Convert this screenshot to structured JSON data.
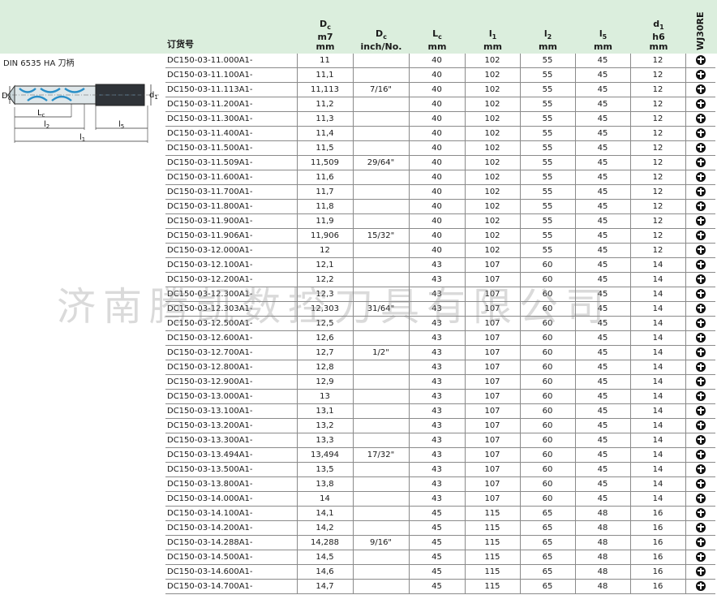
{
  "header": {
    "order_no": "订货号",
    "dc_mm": [
      "D",
      "c",
      "m7",
      "mm"
    ],
    "dc_inch": [
      "D",
      "c",
      "inch/No."
    ],
    "lc": [
      "L",
      "c",
      "mm"
    ],
    "l1": [
      "l",
      "1",
      "mm"
    ],
    "l2": [
      "l",
      "2",
      "mm"
    ],
    "l5": [
      "l",
      "5",
      "mm"
    ],
    "d1": [
      "d",
      "1",
      "h6",
      "mm"
    ],
    "grade": "WJ30RE"
  },
  "product": {
    "label": "DIN 6535 HA 刀柄",
    "drawing_labels": {
      "dc": "Dc",
      "d1": "d1",
      "lc": "Lc",
      "l2": "l2",
      "l5": "l5",
      "l1": "l1"
    }
  },
  "watermark": "济南腾凯数控刀具有限公司",
  "rows": [
    [
      "DC150-03-11.000A1-",
      "11",
      "",
      "40",
      "102",
      "55",
      "45",
      "12"
    ],
    [
      "DC150-03-11.100A1-",
      "11,1",
      "",
      "40",
      "102",
      "55",
      "45",
      "12"
    ],
    [
      "DC150-03-11.113A1-",
      "11,113",
      "7/16\"",
      "40",
      "102",
      "55",
      "45",
      "12"
    ],
    [
      "DC150-03-11.200A1-",
      "11,2",
      "",
      "40",
      "102",
      "55",
      "45",
      "12"
    ],
    [
      "DC150-03-11.300A1-",
      "11,3",
      "",
      "40",
      "102",
      "55",
      "45",
      "12"
    ],
    [
      "DC150-03-11.400A1-",
      "11,4",
      "",
      "40",
      "102",
      "55",
      "45",
      "12"
    ],
    [
      "DC150-03-11.500A1-",
      "11,5",
      "",
      "40",
      "102",
      "55",
      "45",
      "12"
    ],
    [
      "DC150-03-11.509A1-",
      "11,509",
      "29/64\"",
      "40",
      "102",
      "55",
      "45",
      "12"
    ],
    [
      "DC150-03-11.600A1-",
      "11,6",
      "",
      "40",
      "102",
      "55",
      "45",
      "12"
    ],
    [
      "DC150-03-11.700A1-",
      "11,7",
      "",
      "40",
      "102",
      "55",
      "45",
      "12"
    ],
    [
      "DC150-03-11.800A1-",
      "11,8",
      "",
      "40",
      "102",
      "55",
      "45",
      "12"
    ],
    [
      "DC150-03-11.900A1-",
      "11,9",
      "",
      "40",
      "102",
      "55",
      "45",
      "12"
    ],
    [
      "DC150-03-11.906A1-",
      "11,906",
      "15/32\"",
      "40",
      "102",
      "55",
      "45",
      "12"
    ],
    [
      "DC150-03-12.000A1-",
      "12",
      "",
      "40",
      "102",
      "55",
      "45",
      "12"
    ],
    [
      "DC150-03-12.100A1-",
      "12,1",
      "",
      "43",
      "107",
      "60",
      "45",
      "14"
    ],
    [
      "DC150-03-12.200A1-",
      "12,2",
      "",
      "43",
      "107",
      "60",
      "45",
      "14"
    ],
    [
      "DC150-03-12.300A1-",
      "12,3",
      "",
      "43",
      "107",
      "60",
      "45",
      "14"
    ],
    [
      "DC150-03-12.303A1-",
      "12,303",
      "31/64\"",
      "43",
      "107",
      "60",
      "45",
      "14"
    ],
    [
      "DC150-03-12.500A1-",
      "12,5",
      "",
      "43",
      "107",
      "60",
      "45",
      "14"
    ],
    [
      "DC150-03-12.600A1-",
      "12,6",
      "",
      "43",
      "107",
      "60",
      "45",
      "14"
    ],
    [
      "DC150-03-12.700A1-",
      "12,7",
      "1/2\"",
      "43",
      "107",
      "60",
      "45",
      "14"
    ],
    [
      "DC150-03-12.800A1-",
      "12,8",
      "",
      "43",
      "107",
      "60",
      "45",
      "14"
    ],
    [
      "DC150-03-12.900A1-",
      "12,9",
      "",
      "43",
      "107",
      "60",
      "45",
      "14"
    ],
    [
      "DC150-03-13.000A1-",
      "13",
      "",
      "43",
      "107",
      "60",
      "45",
      "14"
    ],
    [
      "DC150-03-13.100A1-",
      "13,1",
      "",
      "43",
      "107",
      "60",
      "45",
      "14"
    ],
    [
      "DC150-03-13.200A1-",
      "13,2",
      "",
      "43",
      "107",
      "60",
      "45",
      "14"
    ],
    [
      "DC150-03-13.300A1-",
      "13,3",
      "",
      "43",
      "107",
      "60",
      "45",
      "14"
    ],
    [
      "DC150-03-13.494A1-",
      "13,494",
      "17/32\"",
      "43",
      "107",
      "60",
      "45",
      "14"
    ],
    [
      "DC150-03-13.500A1-",
      "13,5",
      "",
      "43",
      "107",
      "60",
      "45",
      "14"
    ],
    [
      "DC150-03-13.800A1-",
      "13,8",
      "",
      "43",
      "107",
      "60",
      "45",
      "14"
    ],
    [
      "DC150-03-14.000A1-",
      "14",
      "",
      "43",
      "107",
      "60",
      "45",
      "14"
    ],
    [
      "DC150-03-14.100A1-",
      "14,1",
      "",
      "45",
      "115",
      "65",
      "48",
      "16"
    ],
    [
      "DC150-03-14.200A1-",
      "14,2",
      "",
      "45",
      "115",
      "65",
      "48",
      "16"
    ],
    [
      "DC150-03-14.288A1-",
      "14,288",
      "9/16\"",
      "45",
      "115",
      "65",
      "48",
      "16"
    ],
    [
      "DC150-03-14.500A1-",
      "14,5",
      "",
      "45",
      "115",
      "65",
      "48",
      "16"
    ],
    [
      "DC150-03-14.600A1-",
      "14,6",
      "",
      "45",
      "115",
      "65",
      "48",
      "16"
    ],
    [
      "DC150-03-14.700A1-",
      "14,7",
      "",
      "45",
      "115",
      "65",
      "48",
      "16"
    ]
  ],
  "stock_icon": "stock-available-icon"
}
